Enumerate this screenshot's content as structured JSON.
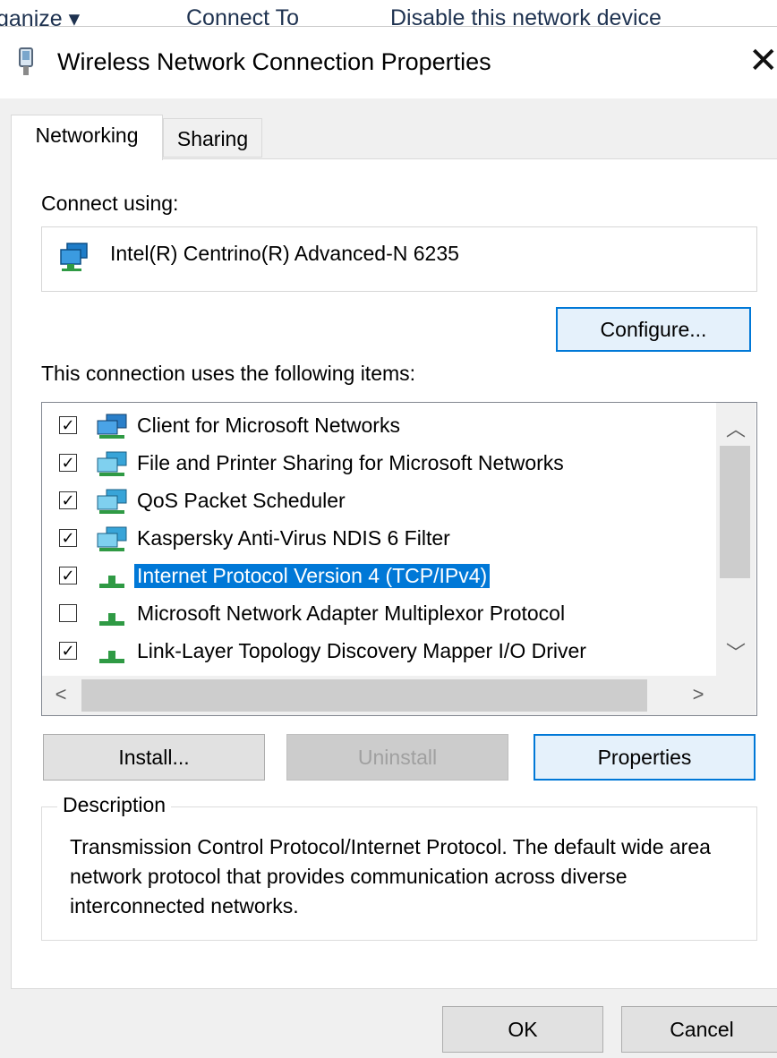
{
  "background_toolbar": {
    "items": [
      "ganize ▾",
      "Connect To",
      "Disable this network device"
    ]
  },
  "window": {
    "title": "Wireless Network Connection Properties",
    "close_glyph": "✕"
  },
  "tabs": [
    {
      "label": "Networking",
      "active": true
    },
    {
      "label": "Sharing",
      "active": false
    }
  ],
  "connect_using": {
    "label": "Connect using:",
    "adapter": "Intel(R) Centrino(R) Advanced-N 6235",
    "configure_label": "Configure..."
  },
  "items_section": {
    "label": "This connection uses the following items:",
    "items": [
      {
        "label": "Client for Microsoft Networks",
        "checked": true,
        "icon": "network-client-icon",
        "selected": false
      },
      {
        "label": "File and Printer Sharing for Microsoft Networks",
        "checked": true,
        "icon": "network-service-icon",
        "selected": false
      },
      {
        "label": "QoS Packet Scheduler",
        "checked": true,
        "icon": "network-service-icon",
        "selected": false
      },
      {
        "label": "Kaspersky Anti-Virus NDIS 6 Filter",
        "checked": true,
        "icon": "network-service-icon",
        "selected": false
      },
      {
        "label": "Internet Protocol Version 4 (TCP/IPv4)",
        "checked": true,
        "icon": "protocol-icon",
        "selected": true
      },
      {
        "label": "Microsoft Network Adapter Multiplexor Protocol",
        "checked": false,
        "icon": "protocol-icon",
        "selected": false
      },
      {
        "label": "Link-Layer Topology Discovery Mapper I/O Driver",
        "checked": true,
        "icon": "protocol-icon",
        "selected": false
      }
    ]
  },
  "buttons": {
    "install": "Install...",
    "uninstall": "Uninstall",
    "properties": "Properties",
    "ok": "OK",
    "cancel": "Cancel"
  },
  "description": {
    "title": "Description",
    "text": "Transmission Control Protocol/Internet Protocol. The default wide area network protocol that provides communication across diverse interconnected networks."
  },
  "colors": {
    "selection": "#0078d7",
    "dialog_bg": "#f0f0f0",
    "panel_bg": "#ffffff"
  }
}
